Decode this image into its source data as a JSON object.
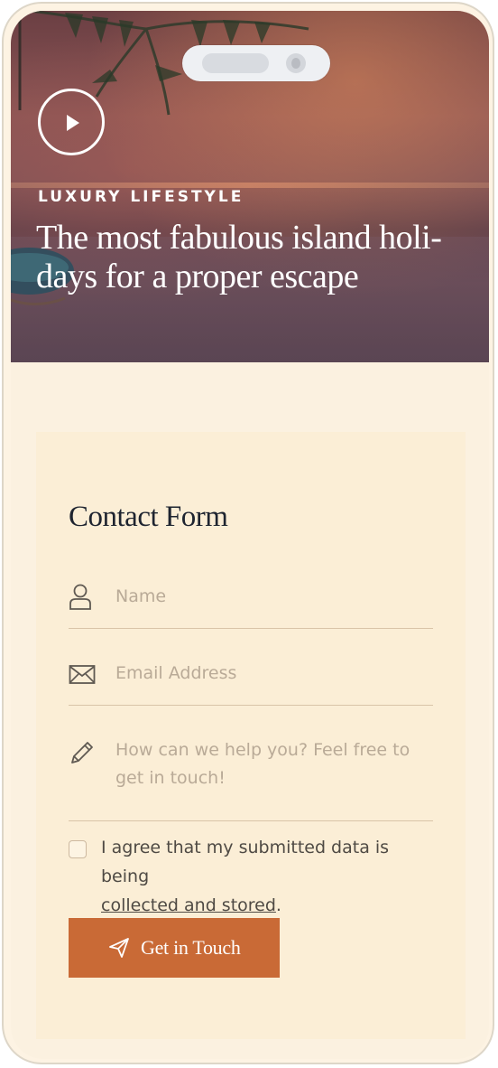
{
  "hero": {
    "kicker": "LUXURY LIFESTYLE",
    "headline_line1": "The most fabulous island holi-",
    "headline_line2": "days for a proper escape"
  },
  "form": {
    "title": "Contact Form",
    "name_placeholder": "Name",
    "email_placeholder": "Email Address",
    "message_placeholder_line1": "How can we help you? Feel free to",
    "message_placeholder_line2": "get in touch!",
    "consent_text": "I agree that my submitted data is being",
    "consent_link": "collected and stored",
    "consent_end": ".",
    "submit_label": "Get in Touch"
  },
  "colors": {
    "accent": "#c96a36",
    "card_background": "#fbeed6",
    "page_background": "#fbf1e0",
    "heading": "#1e2430"
  }
}
